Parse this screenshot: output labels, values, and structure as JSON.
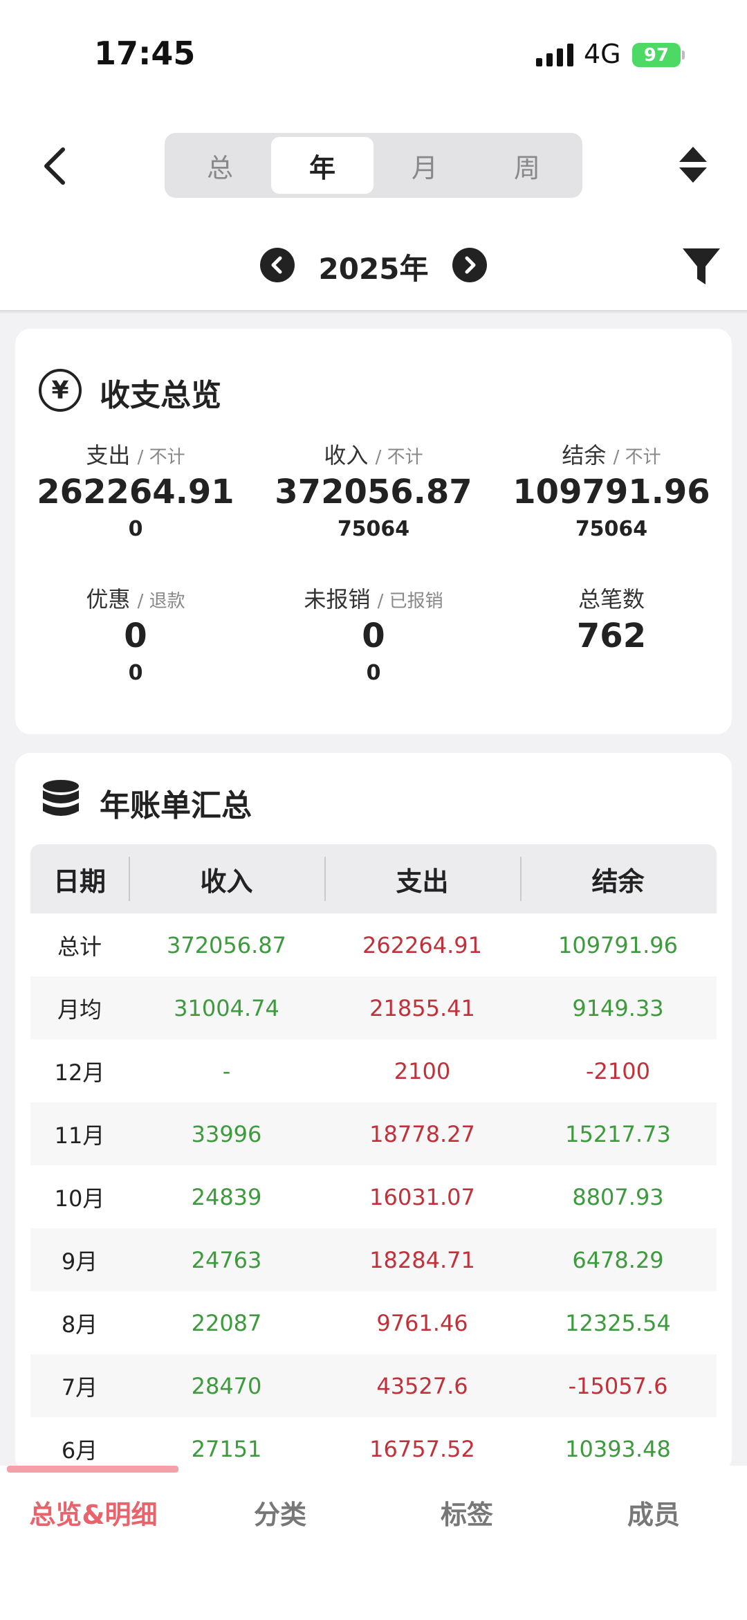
{
  "status_bar": {
    "time": "17:45",
    "network": "4G",
    "battery": "97"
  },
  "header": {
    "segments": [
      {
        "label": "总"
      },
      {
        "label": "年"
      },
      {
        "label": "月"
      },
      {
        "label": "周"
      }
    ],
    "active_segment": "年",
    "year_label": "2025年"
  },
  "overview": {
    "title": "收支总览",
    "stats": [
      {
        "label": "支出",
        "sub": "/ 不计",
        "value": "262264.91",
        "secondary": "0"
      },
      {
        "label": "收入",
        "sub": "/ 不计",
        "value": "372056.87",
        "secondary": "75064"
      },
      {
        "label": "结余",
        "sub": "/ 不计",
        "value": "109791.96",
        "secondary": "75064"
      },
      {
        "label": "优惠",
        "sub": "/ 退款",
        "value": "0",
        "secondary": "0"
      },
      {
        "label": "未报销",
        "sub": "/ 已报销",
        "value": "0",
        "secondary": "0"
      },
      {
        "label": "总笔数",
        "sub": "",
        "value": "762",
        "secondary": ""
      }
    ]
  },
  "summary": {
    "title": "年账单汇总",
    "columns": [
      "日期",
      "收入",
      "支出",
      "结余"
    ],
    "rows": [
      {
        "date": "总计",
        "income": "372056.87",
        "expense": "262264.91",
        "balance": "109791.96"
      },
      {
        "date": "月均",
        "income": "31004.74",
        "expense": "21855.41",
        "balance": "9149.33"
      },
      {
        "date": "12月",
        "income": "-",
        "expense": "2100",
        "balance": "-2100"
      },
      {
        "date": "11月",
        "income": "33996",
        "expense": "18778.27",
        "balance": "15217.73"
      },
      {
        "date": "10月",
        "income": "24839",
        "expense": "16031.07",
        "balance": "8807.93"
      },
      {
        "date": "9月",
        "income": "24763",
        "expense": "18284.71",
        "balance": "6478.29"
      },
      {
        "date": "8月",
        "income": "22087",
        "expense": "9761.46",
        "balance": "12325.54"
      },
      {
        "date": "7月",
        "income": "28470",
        "expense": "43527.6",
        "balance": "-15057.6"
      },
      {
        "date": "6月",
        "income": "27151",
        "expense": "16757.52",
        "balance": "10393.48"
      }
    ]
  },
  "tabs": {
    "items": [
      {
        "label": "总览&明细"
      },
      {
        "label": "分类"
      },
      {
        "label": "标签"
      },
      {
        "label": "成员"
      }
    ],
    "active": "总览&明细"
  },
  "colors": {
    "positive": "#3d9a3d",
    "negative": "#c0313a",
    "accent": "#e8636c",
    "battery": "#4cd964"
  }
}
